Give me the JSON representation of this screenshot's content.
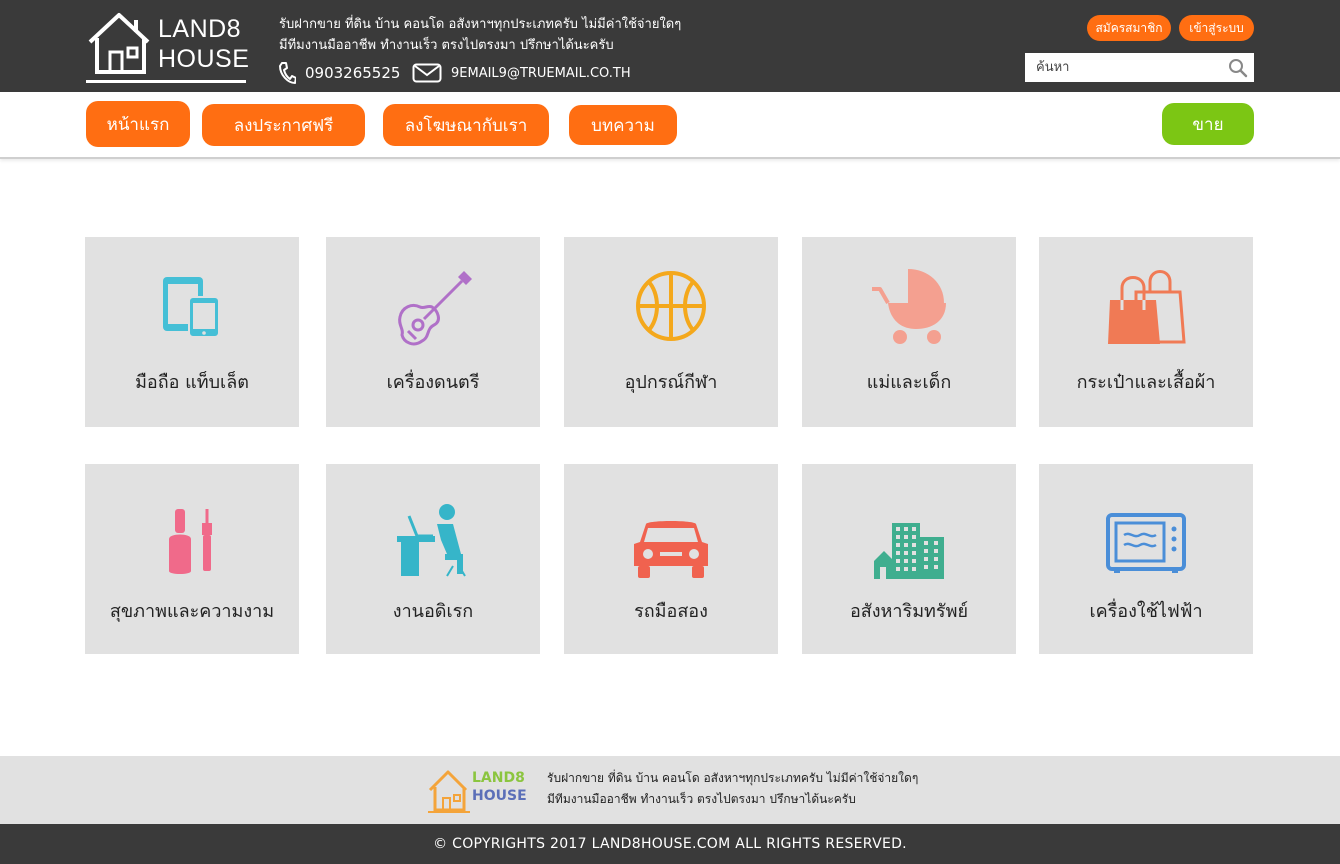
{
  "header": {
    "logo": {
      "line1": "LAND8",
      "line2": "HOUSE"
    },
    "tagline_line1": "รับฝากขาย ที่ดิน บ้าน คอนโด อสังหาฯทุกประเภทครับ ไม่มีค่าใช้จ่ายใดๆ",
    "tagline_line2": "มีทีมงานมืออาชีพ ทำงานเร็ว ตรงไปตรงมา ปรึกษาได้นะครับ",
    "phone": "0903265525",
    "email": "9EMAIL9@TRUEMAIL.CO.TH",
    "register_label": "สมัครสมาชิก",
    "login_label": "เข้าสู่ระบบ",
    "search_placeholder": "ค้นหา"
  },
  "nav": {
    "home": "หน้าแรก",
    "post_free": "ลงประกาศฟรี",
    "advertise": "ลงโฆษณากับเรา",
    "articles": "บทความ",
    "sell": "ขาย"
  },
  "categories": [
    {
      "label": "มือถือ แท็บเล็ต",
      "icon": "mobile-tablet-icon",
      "color": "#45bfd6"
    },
    {
      "label": "เครื่องดนตรี",
      "icon": "guitar-icon",
      "color": "#b070c8"
    },
    {
      "label": "อุปกรณ์กีฬา",
      "icon": "basketball-icon",
      "color": "#f4a81c"
    },
    {
      "label": "แม่และเด็ก",
      "icon": "baby-stroller-icon",
      "color": "#f4a090"
    },
    {
      "label": "กระเป๋าและเสื้อผ้า",
      "icon": "shopping-bag-icon",
      "color": "#f07a55"
    },
    {
      "label": "สุขภาพและความงาม",
      "icon": "nail-polish-icon",
      "color": "#f06a8a"
    },
    {
      "label": "งานอดิเรก",
      "icon": "person-at-computer-icon",
      "color": "#36b5c9"
    },
    {
      "label": "รถมือสอง",
      "icon": "car-icon",
      "color": "#f0624f"
    },
    {
      "label": "อสังหาริมทรัพย์",
      "icon": "buildings-icon",
      "color": "#3fae8f"
    },
    {
      "label": "เครื่องใช้ไฟฟ้า",
      "icon": "microwave-icon",
      "color": "#4a8ed8"
    }
  ],
  "footer": {
    "logo": {
      "line1": "LAND8",
      "line2": "HOUSE"
    },
    "tagline_line1": "รับฝากขาย ที่ดิน บ้าน คอนโด อสังหาฯทุกประเภทครับ ไม่มีค่าใช้จ่ายใดๆ",
    "tagline_line2": "มีทีมงานมืออาชีพ ทำงานเร็ว ตรงไปตรงมา ปรึกษาได้นะครับ",
    "copyright": "© COPYRIGHTS 2017 LAND8HOUSE.COM ALL RIGHTS RESERVED."
  },
  "colors": {
    "header_bg": "#3a3a3a",
    "accent_orange": "#ff6e12",
    "accent_green": "#7cc614",
    "tile_bg": "#e1e1e1"
  }
}
